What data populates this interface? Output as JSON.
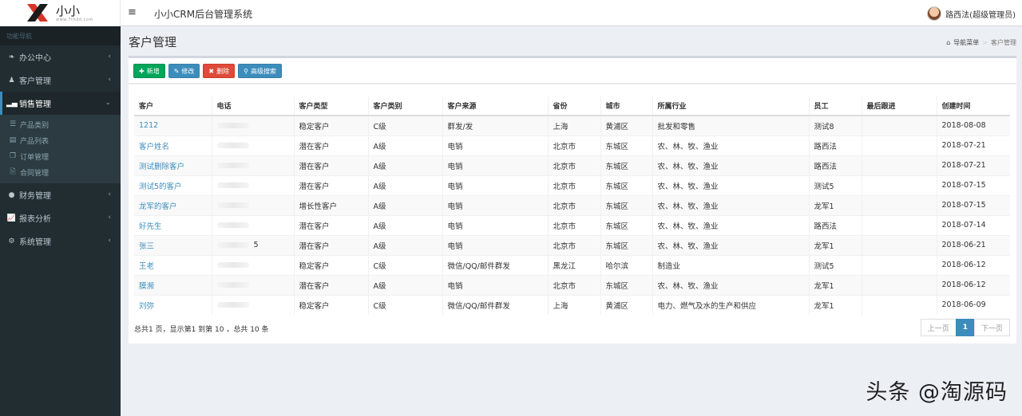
{
  "logo": {
    "text": "小小",
    "sub": "www.7thdd.com"
  },
  "header": {
    "title": "小小CRM后台管理系统",
    "user": "路西法(超级管理员)"
  },
  "sidebar": {
    "heading": "功能导航",
    "items": [
      {
        "label": "办公中心",
        "icon": "leaf-icon"
      },
      {
        "label": "客户管理",
        "icon": "male-icon"
      },
      {
        "label": "销售管理",
        "icon": "bar-chart-icon"
      },
      {
        "label": "财务管理",
        "icon": "circle-dollar-icon"
      },
      {
        "label": "报表分析",
        "icon": "line-chart-icon"
      },
      {
        "label": "系统管理",
        "icon": "gear-icon"
      }
    ],
    "sub": [
      {
        "label": "产品类别",
        "icon": "list-icon"
      },
      {
        "label": "产品列表",
        "icon": "table-icon"
      },
      {
        "label": "订单管理",
        "icon": "copy-icon"
      },
      {
        "label": "合同管理",
        "icon": "file-icon"
      }
    ]
  },
  "page": {
    "title": "客户管理",
    "breadcrumb_home": "导航菜单",
    "breadcrumb_current": "客户管理"
  },
  "toolbar": {
    "add": "新增",
    "edit": "修改",
    "delete": "删除",
    "search": "高级搜索"
  },
  "table": {
    "headers": [
      "客户",
      "电话",
      "客户类型",
      "客户类别",
      "客户来源",
      "省份",
      "城市",
      "所属行业",
      "员工",
      "最后跟进",
      "创建时间"
    ],
    "rows": [
      [
        "1212",
        "",
        "稳定客户",
        "C级",
        "群发/发",
        "上海",
        "黄浦区",
        "批发和零售",
        "测试8",
        "",
        "2018-08-08"
      ],
      [
        "客户姓名",
        "",
        "潜在客户",
        "A级",
        "电销",
        "北京市",
        "东城区",
        "农、林、牧、渔业",
        "路西法",
        "",
        "2018-07-21"
      ],
      [
        "测试删除客户",
        "",
        "潜在客户",
        "A级",
        "电销",
        "北京市",
        "东城区",
        "农、林、牧、渔业",
        "路西法",
        "",
        "2018-07-21"
      ],
      [
        "测试5的客户",
        "",
        "潜在客户",
        "A级",
        "电销",
        "北京市",
        "东城区",
        "农、林、牧、渔业",
        "测试5",
        "",
        "2018-07-15"
      ],
      [
        "龙军的客户",
        "",
        "增长性客户",
        "A级",
        "电销",
        "北京市",
        "东城区",
        "农、林、牧、渔业",
        "龙军1",
        "",
        "2018-07-15"
      ],
      [
        "好先生",
        "",
        "潜在客户",
        "A级",
        "电销",
        "北京市",
        "东城区",
        "农、林、牧、渔业",
        "路西法",
        "",
        "2018-07-14"
      ],
      [
        "张三",
        "5",
        "潜在客户",
        "A级",
        "电销",
        "北京市",
        "东城区",
        "农、林、牧、渔业",
        "龙军1",
        "",
        "2018-06-21"
      ],
      [
        "王老",
        "",
        "稳定客户",
        "C级",
        "微信/QQ/邮件群发",
        "黑龙江",
        "哈尔滨",
        "制造业",
        "测试5",
        "",
        "2018-06-12"
      ],
      [
        "膜濒",
        "",
        "潜在客户",
        "A级",
        "电销",
        "北京市",
        "东城区",
        "农、林、牧、渔业",
        "龙军1",
        "",
        "2018-06-12"
      ],
      [
        "刘弥",
        "",
        "稳定客户",
        "C级",
        "微信/QQ/邮件群发",
        "上海",
        "黄浦区",
        "电力、燃气及水的生产和供应",
        "龙军1",
        "",
        "2018-06-09"
      ]
    ]
  },
  "footer": {
    "summary": "总共1 页，显示第1 到第 10 ，总共 10 条",
    "prev": "上一页",
    "page": "1",
    "next": "下一页"
  },
  "watermark": "头条 @淘源码"
}
